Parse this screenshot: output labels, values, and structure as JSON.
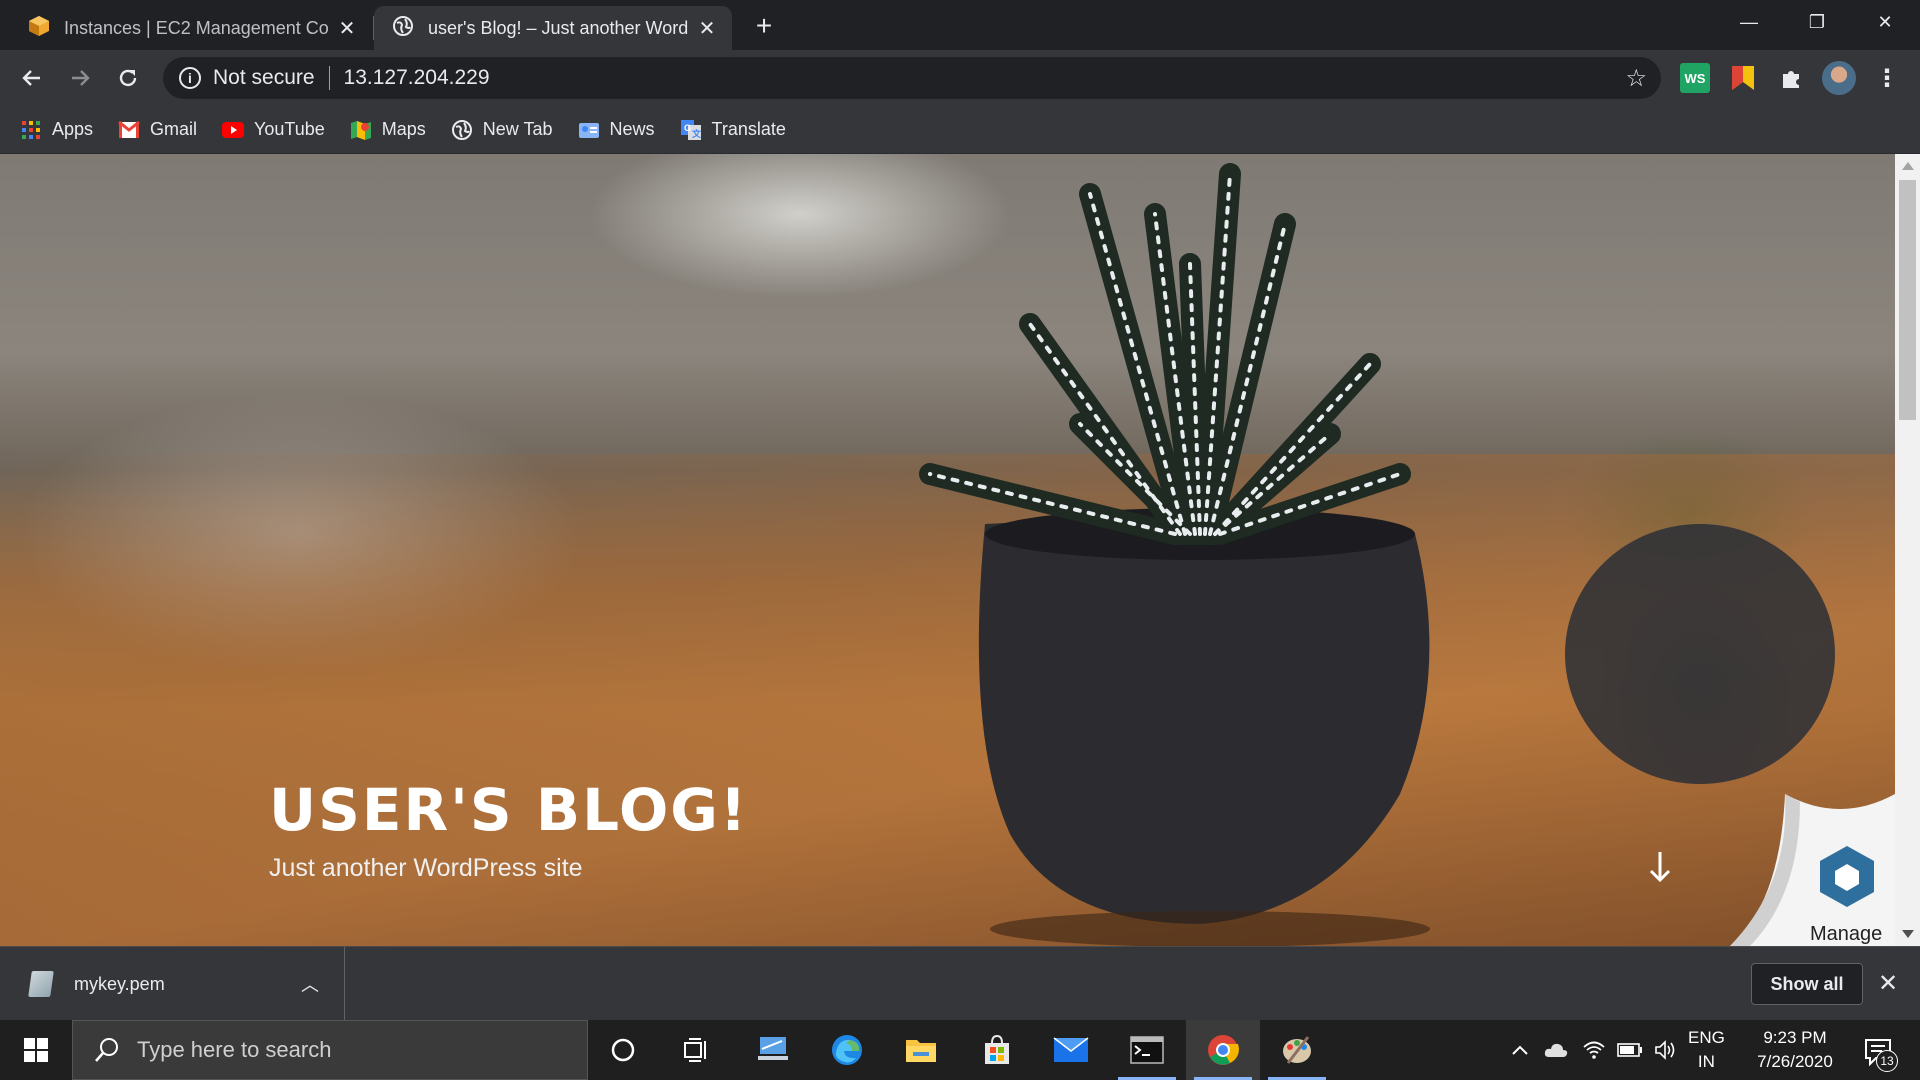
{
  "browser": {
    "tabs": [
      {
        "title": "Instances | EC2 Management Con",
        "active": false
      },
      {
        "title": "user's Blog! – Just another Word",
        "active": true
      }
    ],
    "window_controls": {
      "minimize": "—",
      "restore": "❐",
      "close": "✕"
    }
  },
  "toolbar": {
    "security_label": "Not secure",
    "url": "13.127.204.229",
    "extensions": [
      "ws-extension-icon",
      "bookmark-extension-icon",
      "puzzle-icon",
      "profile-avatar"
    ]
  },
  "bookmarks": [
    {
      "label": "Apps",
      "icon": "apps-grid-icon"
    },
    {
      "label": "Gmail",
      "icon": "gmail-icon"
    },
    {
      "label": "YouTube",
      "icon": "youtube-icon"
    },
    {
      "label": "Maps",
      "icon": "maps-icon"
    },
    {
      "label": "New Tab",
      "icon": "globe-icon"
    },
    {
      "label": "News",
      "icon": "news-icon"
    },
    {
      "label": "Translate",
      "icon": "translate-icon"
    }
  ],
  "page": {
    "site_title": "USER'S BLOG!",
    "site_description": "Just another WordPress site",
    "manage_label": "Manage"
  },
  "downloads": {
    "file_name": "mykey.pem",
    "show_all_label": "Show all"
  },
  "taskbar": {
    "search_placeholder": "Type here to search",
    "language_line1": "ENG",
    "language_line2": "IN",
    "time": "9:23 PM",
    "date": "7/26/2020",
    "notification_count": "13"
  }
}
